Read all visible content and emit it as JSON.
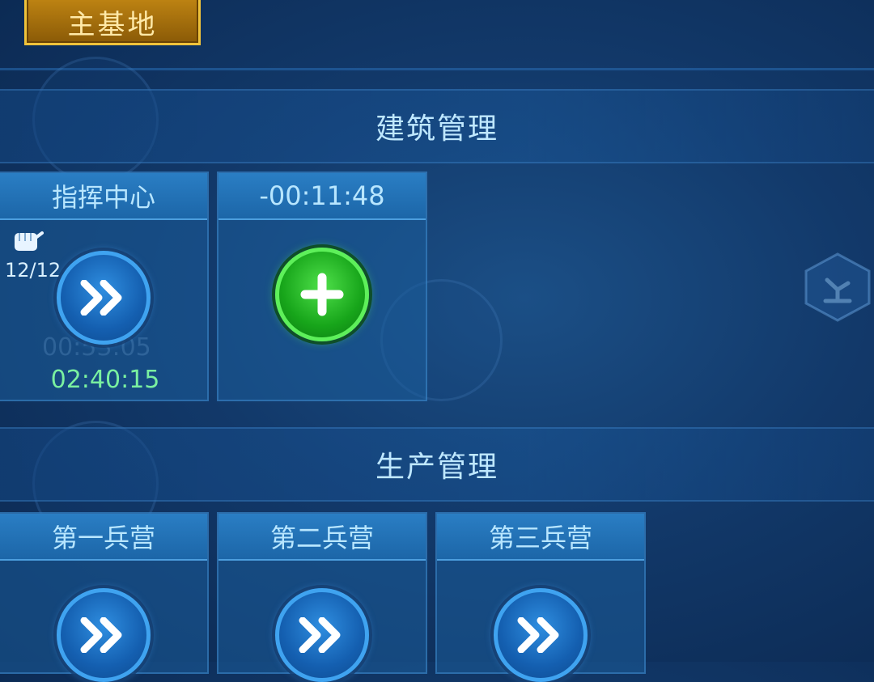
{
  "header": {
    "base_tab_label": "主基地"
  },
  "building_section": {
    "title": "建筑管理",
    "cards": [
      {
        "title": "指挥中心",
        "count": "12/12",
        "timer": "02:40:15",
        "ghost_timer": "00:53:05",
        "action_icon": "double-chevron-right-icon"
      },
      {
        "title": "-00:11:48",
        "action_icon": "plus-icon"
      }
    ]
  },
  "production_section": {
    "title": "生产管理",
    "cards": [
      {
        "title": "第一兵营",
        "action_icon": "double-chevron-right-icon"
      },
      {
        "title": "第二兵营",
        "action_icon": "double-chevron-right-icon"
      },
      {
        "title": "第三兵营",
        "action_icon": "double-chevron-right-icon"
      }
    ]
  },
  "colors": {
    "accent_gold": "#f0c33a",
    "timer_green": "#7af0a0",
    "action_green": "#17a51a",
    "action_blue": "#145fb0"
  }
}
